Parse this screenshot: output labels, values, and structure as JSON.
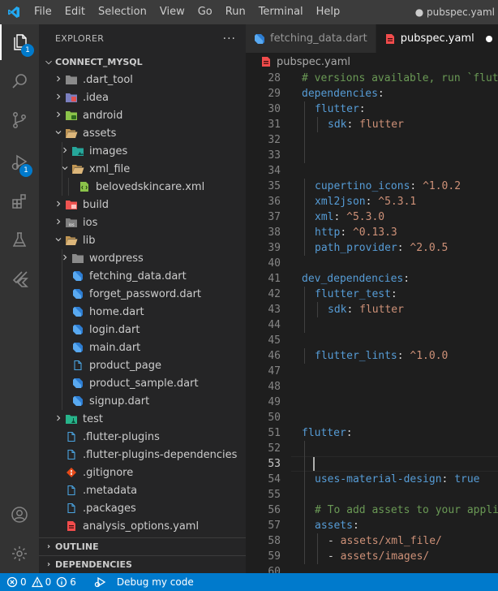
{
  "window": {
    "title": "● pubspec.yaml"
  },
  "menu": [
    "File",
    "Edit",
    "Selection",
    "View",
    "Go",
    "Run",
    "Terminal",
    "Help"
  ],
  "activity_bar": {
    "explorer_badge": "1",
    "debug_badge": "1"
  },
  "sidebar": {
    "header": "EXPLORER",
    "more": "···",
    "root": "CONNECT_MYSQL",
    "items": [
      {
        "label": ".dart_tool",
        "kind": "folder",
        "icon": "folder-grey-icon",
        "open": false,
        "depth": 1
      },
      {
        "label": ".idea",
        "kind": "folder",
        "icon": "folder-idea-icon",
        "open": false,
        "depth": 1
      },
      {
        "label": "android",
        "kind": "folder",
        "icon": "folder-android-icon",
        "open": false,
        "depth": 1
      },
      {
        "label": "assets",
        "kind": "folder",
        "icon": "folder-open-icon",
        "open": true,
        "depth": 1
      },
      {
        "label": "images",
        "kind": "folder",
        "icon": "folder-images-icon",
        "open": false,
        "depth": 2
      },
      {
        "label": "xml_file",
        "kind": "folder",
        "icon": "folder-open-icon",
        "open": true,
        "depth": 2
      },
      {
        "label": "belovedskincare.xml",
        "kind": "file",
        "icon": "xml-file-icon",
        "depth": 3
      },
      {
        "label": "build",
        "kind": "folder",
        "icon": "folder-build-icon",
        "open": false,
        "depth": 1
      },
      {
        "label": "ios",
        "kind": "folder",
        "icon": "folder-ios-icon",
        "open": false,
        "depth": 1
      },
      {
        "label": "lib",
        "kind": "folder",
        "icon": "folder-open-icon",
        "open": true,
        "depth": 1
      },
      {
        "label": "wordpress",
        "kind": "folder",
        "icon": "folder-grey-icon",
        "open": false,
        "depth": 2
      },
      {
        "label": "fetching_data.dart",
        "kind": "file",
        "icon": "dart-file-icon",
        "depth": 2
      },
      {
        "label": "forget_password.dart",
        "kind": "file",
        "icon": "dart-file-icon",
        "depth": 2
      },
      {
        "label": "home.dart",
        "kind": "file",
        "icon": "dart-file-icon",
        "depth": 2
      },
      {
        "label": "login.dart",
        "kind": "file",
        "icon": "dart-file-icon",
        "depth": 2
      },
      {
        "label": "main.dart",
        "kind": "file",
        "icon": "dart-file-icon",
        "depth": 2
      },
      {
        "label": "product_page",
        "kind": "file",
        "icon": "blank-file-icon",
        "depth": 2
      },
      {
        "label": "product_sample.dart",
        "kind": "file",
        "icon": "dart-file-icon",
        "depth": 2
      },
      {
        "label": "signup.dart",
        "kind": "file",
        "icon": "dart-file-icon",
        "depth": 2
      },
      {
        "label": "test",
        "kind": "folder",
        "icon": "folder-test-icon",
        "open": false,
        "depth": 1
      },
      {
        "label": ".flutter-plugins",
        "kind": "file",
        "icon": "blank-file-icon",
        "depth": 1
      },
      {
        "label": ".flutter-plugins-dependencies",
        "kind": "file",
        "icon": "blank-file-icon",
        "depth": 1
      },
      {
        "label": ".gitignore",
        "kind": "file",
        "icon": "git-file-icon",
        "depth": 1
      },
      {
        "label": ".metadata",
        "kind": "file",
        "icon": "blank-file-icon",
        "depth": 1
      },
      {
        "label": ".packages",
        "kind": "file",
        "icon": "blank-file-icon",
        "depth": 1
      },
      {
        "label": "analysis_options.yaml",
        "kind": "file",
        "icon": "yaml-file-icon",
        "depth": 1
      }
    ],
    "outline": "OUTLINE",
    "dependencies": "DEPENDENCIES"
  },
  "tabs": [
    {
      "label": "fetching_data.dart",
      "icon": "dart-file-icon",
      "active": false
    },
    {
      "label": "pubspec.yaml",
      "icon": "yaml-file-icon",
      "active": true,
      "dirty": true
    }
  ],
  "breadcrumb": "pubspec.yaml",
  "code": {
    "current_line": 53,
    "lines": [
      {
        "n": 28,
        "indent": 0,
        "tokens": [
          {
            "t": "# versions available, run `flutt",
            "c": "c"
          }
        ]
      },
      {
        "n": 29,
        "indent": 0,
        "tokens": [
          {
            "t": "dependencies",
            "c": "k"
          },
          {
            "t": ":",
            "c": "p"
          }
        ]
      },
      {
        "n": 30,
        "indent": 1,
        "tokens": [
          {
            "t": "flutter",
            "c": "k"
          },
          {
            "t": ":",
            "c": "p"
          }
        ]
      },
      {
        "n": 31,
        "indent": 2,
        "tokens": [
          {
            "t": "sdk",
            "c": "k"
          },
          {
            "t": ": ",
            "c": "p"
          },
          {
            "t": "flutter",
            "c": "s"
          }
        ]
      },
      {
        "n": 32,
        "indent": 1,
        "tokens": []
      },
      {
        "n": 33,
        "indent": 1,
        "tokens": []
      },
      {
        "n": 34,
        "indent": 0,
        "tokens": []
      },
      {
        "n": 35,
        "indent": 1,
        "tokens": [
          {
            "t": "cupertino_icons",
            "c": "k"
          },
          {
            "t": ": ",
            "c": "p"
          },
          {
            "t": "^1.0.2",
            "c": "s"
          }
        ]
      },
      {
        "n": 36,
        "indent": 1,
        "tokens": [
          {
            "t": "xml2json",
            "c": "k"
          },
          {
            "t": ": ",
            "c": "p"
          },
          {
            "t": "^5.3.1",
            "c": "s"
          }
        ]
      },
      {
        "n": 37,
        "indent": 1,
        "tokens": [
          {
            "t": "xml",
            "c": "k"
          },
          {
            "t": ": ",
            "c": "p"
          },
          {
            "t": "^5.3.0",
            "c": "s"
          }
        ]
      },
      {
        "n": 38,
        "indent": 1,
        "tokens": [
          {
            "t": "http",
            "c": "k"
          },
          {
            "t": ": ",
            "c": "p"
          },
          {
            "t": "^0.13.3",
            "c": "s"
          }
        ]
      },
      {
        "n": 39,
        "indent": 1,
        "tokens": [
          {
            "t": "path_provider",
            "c": "k"
          },
          {
            "t": ": ",
            "c": "p"
          },
          {
            "t": "^2.0.5",
            "c": "s"
          }
        ]
      },
      {
        "n": 40,
        "indent": 0,
        "tokens": []
      },
      {
        "n": 41,
        "indent": 0,
        "tokens": [
          {
            "t": "dev_dependencies",
            "c": "k"
          },
          {
            "t": ":",
            "c": "p"
          }
        ]
      },
      {
        "n": 42,
        "indent": 1,
        "tokens": [
          {
            "t": "flutter_test",
            "c": "k"
          },
          {
            "t": ":",
            "c": "p"
          }
        ]
      },
      {
        "n": 43,
        "indent": 2,
        "tokens": [
          {
            "t": "sdk",
            "c": "k"
          },
          {
            "t": ": ",
            "c": "p"
          },
          {
            "t": "flutter",
            "c": "s"
          }
        ]
      },
      {
        "n": 44,
        "indent": 1,
        "tokens": []
      },
      {
        "n": 45,
        "indent": 0,
        "tokens": []
      },
      {
        "n": 46,
        "indent": 1,
        "tokens": [
          {
            "t": "flutter_lints",
            "c": "k"
          },
          {
            "t": ": ",
            "c": "p"
          },
          {
            "t": "^1.0.0",
            "c": "s"
          }
        ]
      },
      {
        "n": 47,
        "indent": 0,
        "tokens": []
      },
      {
        "n": 48,
        "indent": 0,
        "tokens": []
      },
      {
        "n": 49,
        "indent": 0,
        "tokens": []
      },
      {
        "n": 50,
        "indent": 0,
        "tokens": []
      },
      {
        "n": 51,
        "indent": 0,
        "tokens": [
          {
            "t": "flutter",
            "c": "k"
          },
          {
            "t": ":",
            "c": "p"
          }
        ]
      },
      {
        "n": 52,
        "indent": 1,
        "tokens": []
      },
      {
        "n": 53,
        "indent": 1,
        "tokens": []
      },
      {
        "n": 54,
        "indent": 1,
        "tokens": [
          {
            "t": "uses-material-design",
            "c": "k"
          },
          {
            "t": ": ",
            "c": "p"
          },
          {
            "t": "true",
            "c": "b"
          }
        ]
      },
      {
        "n": 55,
        "indent": 1,
        "tokens": []
      },
      {
        "n": 56,
        "indent": 1,
        "tokens": [
          {
            "t": "# To add assets to your applic",
            "c": "c"
          }
        ]
      },
      {
        "n": 57,
        "indent": 1,
        "tokens": [
          {
            "t": "assets",
            "c": "k"
          },
          {
            "t": ":",
            "c": "p"
          }
        ]
      },
      {
        "n": 58,
        "indent": 2,
        "tokens": [
          {
            "t": "- ",
            "c": "p"
          },
          {
            "t": "assets/xml_file/",
            "c": "s"
          }
        ]
      },
      {
        "n": 59,
        "indent": 2,
        "tokens": [
          {
            "t": "- ",
            "c": "p"
          },
          {
            "t": "assets/images/",
            "c": "s"
          }
        ]
      },
      {
        "n": 60,
        "indent": 0,
        "tokens": []
      }
    ]
  },
  "status": {
    "errors": "0",
    "warnings": "0",
    "infos": "6",
    "debug_label": "Debug my code"
  },
  "colors": {
    "accent": "#007acc",
    "yaml_key": "#569cd6",
    "yaml_string": "#ce9178",
    "comment": "#6a9955",
    "dart_blue": "#2d7dd2",
    "yaml_red": "#f14c4c"
  }
}
